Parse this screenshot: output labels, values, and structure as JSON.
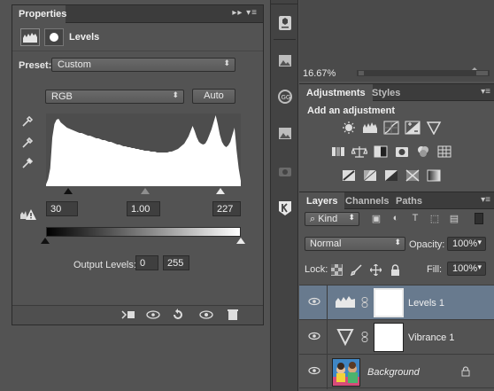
{
  "properties": {
    "tab_label": "Properties",
    "title": "Levels",
    "preset_label": "Preset:",
    "preset_value": "Custom",
    "channel_value": "RGB",
    "auto_label": "Auto",
    "input_black": "30",
    "input_gamma": "1.00",
    "input_white": "227",
    "output_label": "Output Levels:",
    "output_black": "0",
    "output_white": "255",
    "histogram": [
      2,
      8,
      20,
      55,
      70,
      75,
      76,
      72,
      70,
      68,
      66,
      65,
      64,
      63,
      62,
      61,
      60,
      60,
      59,
      58,
      57,
      57,
      56,
      55,
      54,
      54,
      53,
      52,
      52,
      51,
      50,
      50,
      49,
      48,
      47,
      47,
      46,
      45,
      45,
      44,
      44,
      43,
      43,
      42,
      42,
      41,
      41,
      40,
      40,
      40,
      39,
      39,
      39,
      38,
      38,
      38,
      38,
      38,
      38,
      39,
      39,
      40,
      41,
      42,
      44,
      46,
      48,
      52,
      56,
      62,
      68,
      62,
      55,
      50,
      48,
      47,
      48,
      52,
      58,
      64,
      72,
      80,
      70,
      58,
      50,
      46,
      44,
      46,
      50,
      58,
      66,
      40,
      20,
      6
    ]
  },
  "dock": {
    "icons": [
      "3d-icon",
      "image-icon",
      "cc-icon",
      "image-icon",
      "camera-icon",
      "k-icon"
    ]
  },
  "status": {
    "zoom": "16.67%"
  },
  "adjustments": {
    "tabs": [
      "Adjustments",
      "Styles"
    ],
    "add_label": "Add an adjustment",
    "rows": [
      [
        "brightness-icon",
        "levels-icon",
        "curves-icon",
        "exposure-icon",
        "vibrance-icon"
      ],
      [
        "hue-sat-icon",
        "color-balance-icon",
        "black-white-icon",
        "photo-filter-icon",
        "channel-mixer-icon",
        "color-lookup-icon"
      ],
      [
        "invert-icon",
        "posterize-icon",
        "threshold-icon",
        "selective-color-icon",
        "gradient-map-icon"
      ]
    ]
  },
  "layers": {
    "tabs": [
      "Layers",
      "Channels",
      "Paths"
    ],
    "filter_label": "Kind",
    "blend_mode": "Normal",
    "opacity_label": "Opacity:",
    "opacity_value": "100%",
    "lock_label": "Lock:",
    "fill_label": "Fill:",
    "fill_value": "100%",
    "items": [
      {
        "name": "Levels 1",
        "type": "levels-adjustment",
        "selected": true
      },
      {
        "name": "Vibrance 1",
        "type": "vibrance-adjustment",
        "selected": false
      },
      {
        "name": "Background",
        "type": "image",
        "selected": false
      }
    ]
  },
  "colors": {
    "panel_bg": "#535353",
    "tabbar_bg": "#3c3c3c",
    "selected_layer": "#687a8e"
  }
}
